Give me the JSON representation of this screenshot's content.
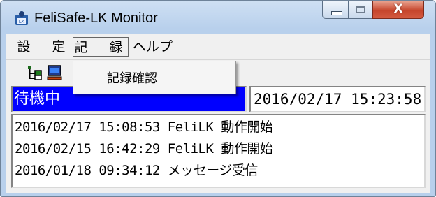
{
  "window": {
    "title": "FeliSafe-LK Monitor",
    "close_glyph": "X"
  },
  "menubar": {
    "items": [
      "設　定",
      "記　録",
      "ヘルプ"
    ]
  },
  "dropdown": {
    "items": [
      "記録確認"
    ]
  },
  "toolbar": {
    "buttons": [
      "network-tree-icon",
      "monitor-icon"
    ]
  },
  "status": {
    "state": "待機中",
    "datetime": "2016/02/17  15:23:58"
  },
  "log": [
    "2016/02/17 15:08:53 FeliLK 動作開始",
    "2016/02/15 16:42:29 FeliLK 動作開始",
    "2016/01/18 09:34:12 メッセージ受信"
  ],
  "colors": {
    "status_bg": "#0000ff",
    "status_fg": "#ffffff",
    "titlebar": "#b8d0ec",
    "close_button": "#c6452c"
  }
}
